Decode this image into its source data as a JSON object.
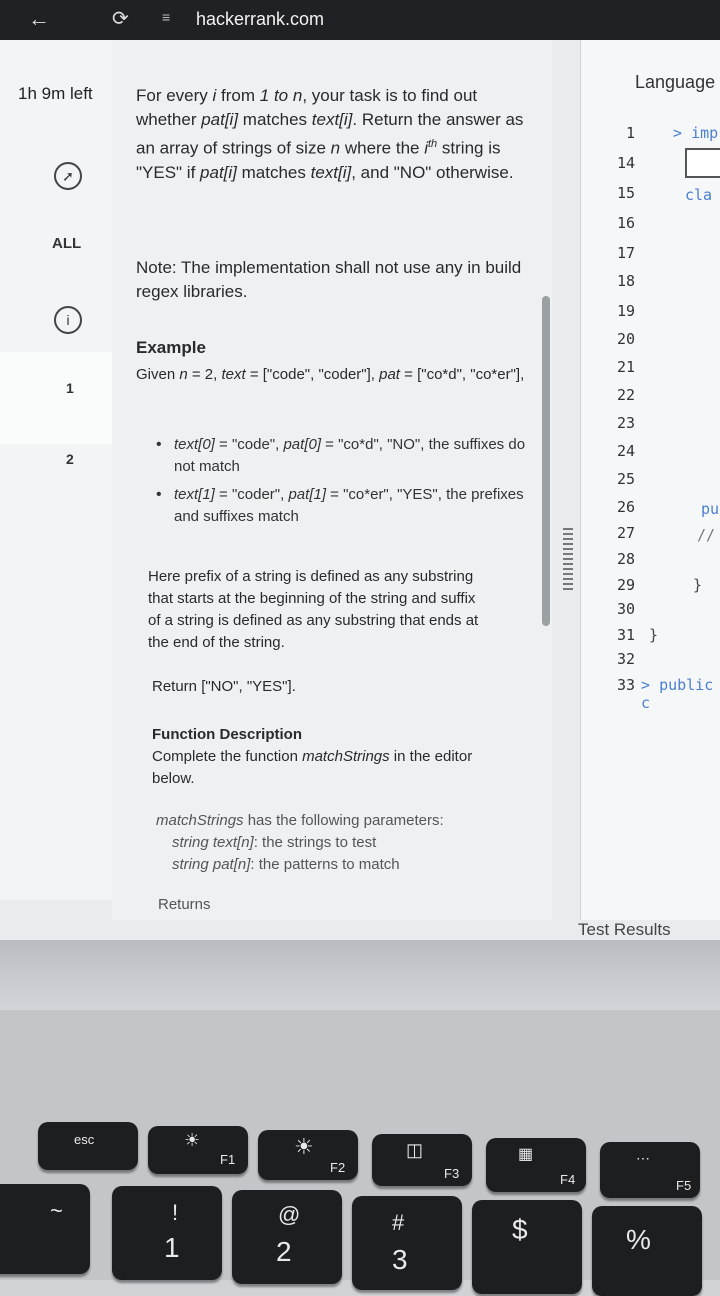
{
  "browser": {
    "url": "hackerrank.com"
  },
  "sidebar": {
    "time_left": "1h 9m left",
    "all_label": "ALL",
    "q1": "1",
    "q2": "2"
  },
  "problem": {
    "p1a": "For every ",
    "p1_i": "i",
    "p1b": " from ",
    "p1_range": "1 to n",
    "p1c": ", your task is to find out whether ",
    "p1_pat": "pat[i]",
    "p1d": " matches ",
    "p1_text": "text[i]",
    "p1e": ". Return the answer as an array of strings of size ",
    "p1_n": "n",
    "p1f": " where the ",
    "p1_ith": "i",
    "p1_th": "th",
    "p1g": " string is \"YES\" if ",
    "p1_pat2": "pat[i]",
    "p1h": " matches ",
    "p1_text2": "text[i]",
    "p1i": ", and \"NO\" otherwise.",
    "note": "Note: The implementation shall not use any in build regex libraries.",
    "example_heading": "Example",
    "given_a": "Given ",
    "given_n": "n",
    "given_b": " = 2, ",
    "given_text": "text",
    "given_c": " = [\"code\", \"coder\"], ",
    "given_pat": "pat",
    "given_d": " = [\"co*d\", \"co*er\"],",
    "b1_text": "text[0]",
    "b1_a": " = \"code\", ",
    "b1_pat": "pat[0]",
    "b1_b": " = \"co*d\", \"NO\", the suffixes do not match",
    "b2_text": "text[1]",
    "b2_a": " = \"coder\", ",
    "b2_pat": "pat[1]",
    "b2_b": " = \"co*er\", \"YES\", the prefixes and suffixes match",
    "prefix_def": "Here prefix of a string is defined as any substring that starts at the beginning of the string and suffix of a string is defined as any substring that ends at the end of the string.",
    "return_line": "Return [\"NO\", \"YES\"].",
    "func_heading": "Function Description",
    "func_a": "Complete the function ",
    "func_name": "matchStrings",
    "func_b": " in the editor below.",
    "params_a": "matchStrings",
    "params_b": " has the following parameters:",
    "param1_a": "string text[n]",
    "param1_b": ": the strings to test",
    "param2_a": "string pat[n]",
    "param2_b": ": the patterns to match",
    "returns_heading": "Returns"
  },
  "editor": {
    "language_label": "Language",
    "line_numbers": [
      "1",
      "14",
      "15",
      "16",
      "17",
      "18",
      "19",
      "20",
      "21",
      "22",
      "23",
      "24",
      "25",
      "26",
      "27",
      "28",
      "29",
      "30",
      "31",
      "32",
      "33"
    ],
    "line1_code": "imp",
    "line15_code": "cla",
    "line26_code": "pu",
    "line27_code": "//",
    "line29_code": "}",
    "line31_code": "}",
    "line33_code": "public c",
    "fold_glyph": ">"
  },
  "test_results_label": "Test Results",
  "keyboard": {
    "esc": "esc",
    "f1": "F1",
    "f2": "F2",
    "f3": "F3",
    "f4": "F4",
    "f5": "F5",
    "tilde": "~",
    "excl": "!",
    "one": "1",
    "at": "@",
    "two": "2",
    "hash": "#",
    "three": "3",
    "dollar": "$",
    "percent": "%"
  }
}
